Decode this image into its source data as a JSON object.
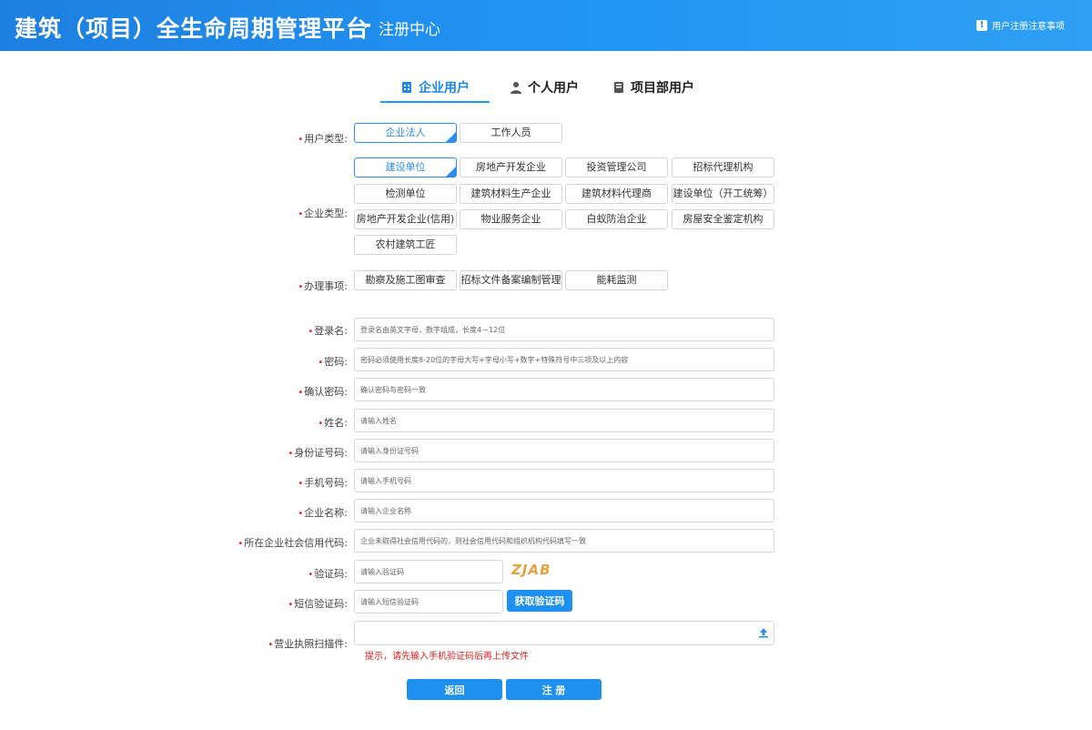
{
  "header": {
    "title": "建筑（项目）全生命周期管理平台",
    "dash": "-",
    "subtitle": "注册中心",
    "notice": "用户注册注意事项",
    "notice_icon": "!"
  },
  "tabs": [
    {
      "label": "企业用户",
      "icon": "enterprise-icon",
      "active": true
    },
    {
      "label": "个人用户",
      "icon": "person-icon",
      "active": false
    },
    {
      "label": "项目部用户",
      "icon": "book-icon",
      "active": false
    }
  ],
  "user_type": {
    "label": "用户类型:",
    "options": [
      "企业法人",
      "工作人员"
    ],
    "selected": "企业法人"
  },
  "enterprise_type": {
    "label": "企业类型:",
    "options": [
      "建设单位",
      "房地产开发企业",
      "投资管理公司",
      "招标代理机构",
      "检测单位",
      "建筑材料生产企业",
      "建筑材料代理商",
      "建设单位（开工统筹）",
      "房地产开发企业(信用)",
      "物业服务企业",
      "白蚁防治企业",
      "房屋安全鉴定机构",
      "农村建筑工匠"
    ],
    "selected": "建设单位"
  },
  "business": {
    "label": "办理事项:",
    "options": [
      "勘察及施工图审查",
      "招标文件备案编制管理",
      "能耗监测"
    ]
  },
  "fields": {
    "login": {
      "label": "登录名:",
      "placeholder": "登录名由英文字母，数字组成，长度4－12位"
    },
    "password": {
      "label": "密码:",
      "placeholder": "密码必须使用长度8-20位的字母大写+字母小写+数字+特殊符号中三项及以上内容"
    },
    "confirm": {
      "label": "确认密码:",
      "placeholder": "确认密码与密码一致"
    },
    "name": {
      "label": "姓名:",
      "placeholder": "请输入姓名"
    },
    "idcard": {
      "label": "身份证号码:",
      "placeholder": "请输入身份证号码"
    },
    "phone": {
      "label": "手机号码:",
      "placeholder": "请输入手机号码"
    },
    "company": {
      "label": "企业名称:",
      "placeholder": "请输入企业名称"
    },
    "credit": {
      "label": "所在企业社会信用代码:",
      "placeholder": "企业未取得社会信用代码的，则社会信用代码和组织机构代码填写一致"
    },
    "captcha": {
      "label": "验证码:",
      "placeholder": "请输入验证码"
    },
    "sms": {
      "label": "短信验证码:",
      "placeholder": "请输入短信验证码"
    },
    "license": {
      "label": "营业执照扫描件:"
    }
  },
  "captcha_text": "ZJAB",
  "sms_button": "获取验证码",
  "upload_hint": "提示，请先输入手机验证码后再上传文件",
  "buttons": {
    "back": "返回",
    "submit": "注 册"
  },
  "colors": {
    "accent": "#1e90f0",
    "required": "#e02020",
    "captcha": "#e6a23c"
  }
}
